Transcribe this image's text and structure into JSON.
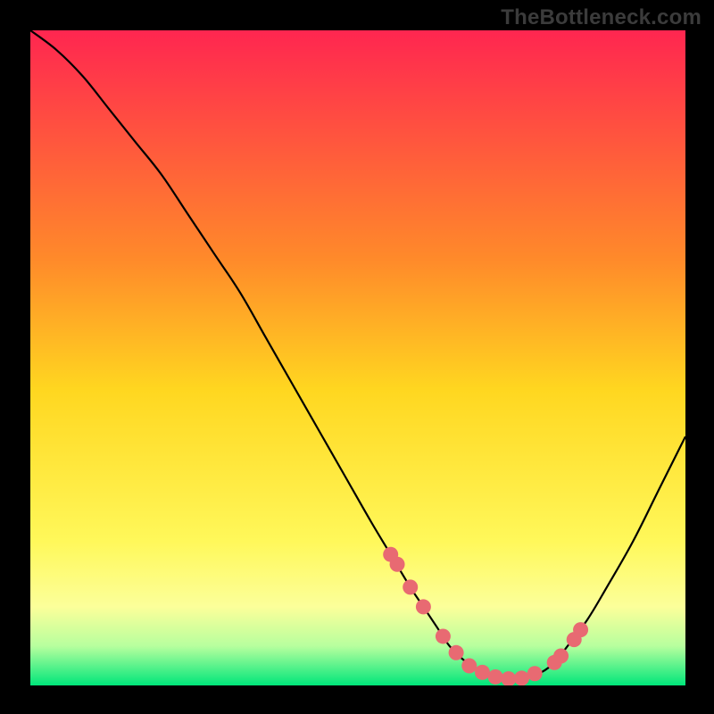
{
  "watermark": "TheBottleneck.com",
  "colors": {
    "frame": "#000000",
    "watermark": "#3b3b3b",
    "curve": "#000000",
    "marker_fill": "#e86a72",
    "marker_stroke": "#d65660",
    "gradient_top": "#ff2650",
    "gradient_mid_upper": "#ff8a2a",
    "gradient_mid": "#ffd720",
    "gradient_lower": "#fff85a",
    "gradient_pale": "#fcff9a",
    "gradient_green_pale": "#b7ff9e",
    "gradient_green": "#00e67a"
  },
  "chart_data": {
    "type": "line",
    "title": "",
    "xlabel": "",
    "ylabel": "",
    "xlim": [
      0,
      100
    ],
    "ylim": [
      0,
      100
    ],
    "series": [
      {
        "name": "bottleneck-curve",
        "x": [
          0,
          4,
          8,
          12,
          16,
          20,
          24,
          28,
          32,
          36,
          40,
          44,
          48,
          52,
          55,
          58,
          60,
          62,
          64,
          66,
          68,
          70,
          72,
          74,
          76,
          78,
          80,
          82,
          85,
          88,
          92,
          96,
          100
        ],
        "y": [
          100,
          97,
          93,
          88,
          83,
          78,
          72,
          66,
          60,
          53,
          46,
          39,
          32,
          25,
          20,
          15,
          12,
          9,
          6,
          4,
          2.5,
          1.5,
          1,
          1,
          1.3,
          2,
          3.5,
          6,
          10,
          15,
          22,
          30,
          38
        ]
      }
    ],
    "markers": {
      "name": "highlighted-points",
      "x": [
        55,
        56,
        58,
        60,
        63,
        65,
        67,
        69,
        71,
        73,
        75,
        77,
        80,
        81,
        83,
        84
      ],
      "y": [
        20,
        18.5,
        15,
        12,
        7.5,
        5,
        3,
        2,
        1.3,
        1,
        1.1,
        1.8,
        3.5,
        4.5,
        7,
        8.5
      ]
    }
  }
}
